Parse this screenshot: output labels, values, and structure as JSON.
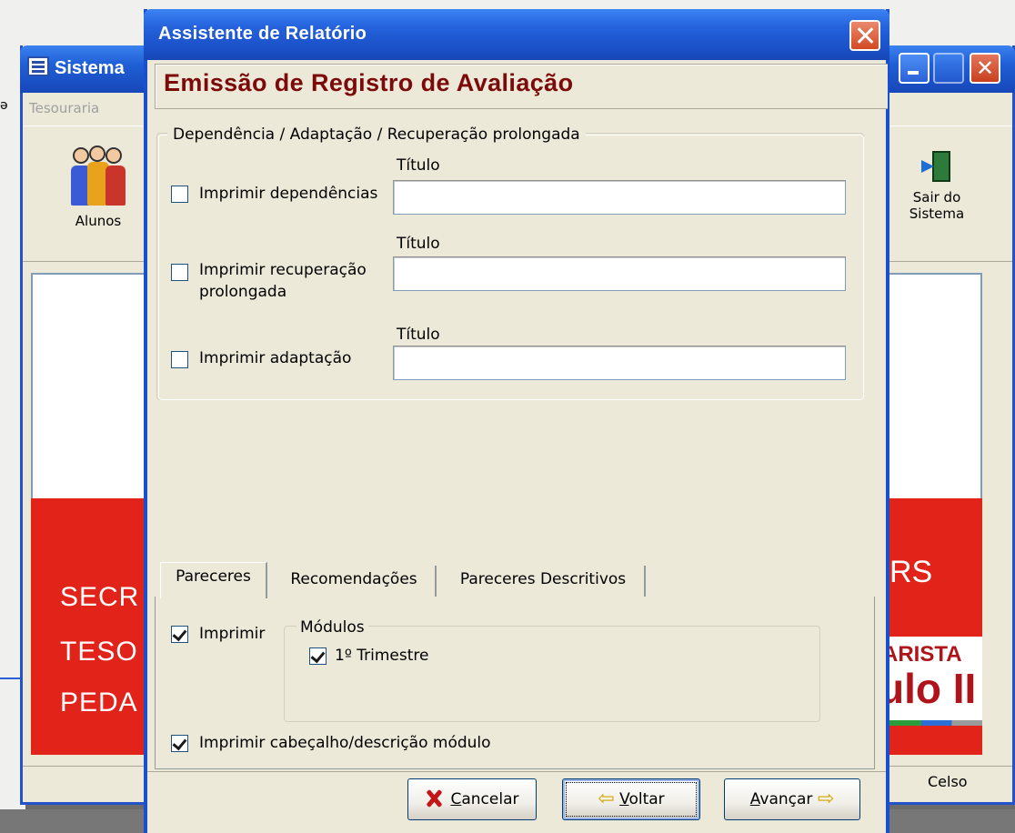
{
  "background_app": {
    "title": "Sistema",
    "menu_item": "Tesouraria",
    "toolbar": {
      "alunos_label": "Alunos",
      "sair_label_line1": "Sair do",
      "sair_label_line2": "Sistema"
    },
    "banner_text": [
      "SECR",
      "TESO",
      "PEDA"
    ],
    "logo_sign": "RS",
    "logo_line1": "ARISTA",
    "logo_line2": "ulo II",
    "status_user": "Celso"
  },
  "dialog": {
    "title": "Assistente de Relatório",
    "header": "Emissão de Registro de Avaliação",
    "group_label": "Dependência / Adaptação / Recuperação prolongada",
    "options": [
      {
        "label": "Imprimir dependências",
        "checked": false,
        "title_label": "Título",
        "title_value": ""
      },
      {
        "label_line1": "Imprimir recuperação",
        "label_line2": "prolongada",
        "checked": false,
        "title_label": "Título",
        "title_value": ""
      },
      {
        "label": "Imprimir adaptação",
        "checked": false,
        "title_label": "Título",
        "title_value": ""
      }
    ],
    "tabs": [
      {
        "label": "Pareceres",
        "active": true
      },
      {
        "label": "Recomendações",
        "active": false
      },
      {
        "label": "Pareceres Descritivos",
        "active": false
      }
    ],
    "pareceres": {
      "imprimir_label": "Imprimir",
      "imprimir_checked": true,
      "modules_label": "Módulos",
      "modules": [
        {
          "label": "1º Trimestre",
          "checked": true
        }
      ],
      "header_label": "Imprimir cabeçalho/descrição módulo",
      "header_checked": true
    },
    "buttons": {
      "cancel_prefix": "",
      "cancel_underlined": "C",
      "cancel_rest": "ancelar",
      "back_underlined": "V",
      "back_rest": "oltar",
      "next_underlined": "A",
      "next_rest": "vançar"
    }
  }
}
